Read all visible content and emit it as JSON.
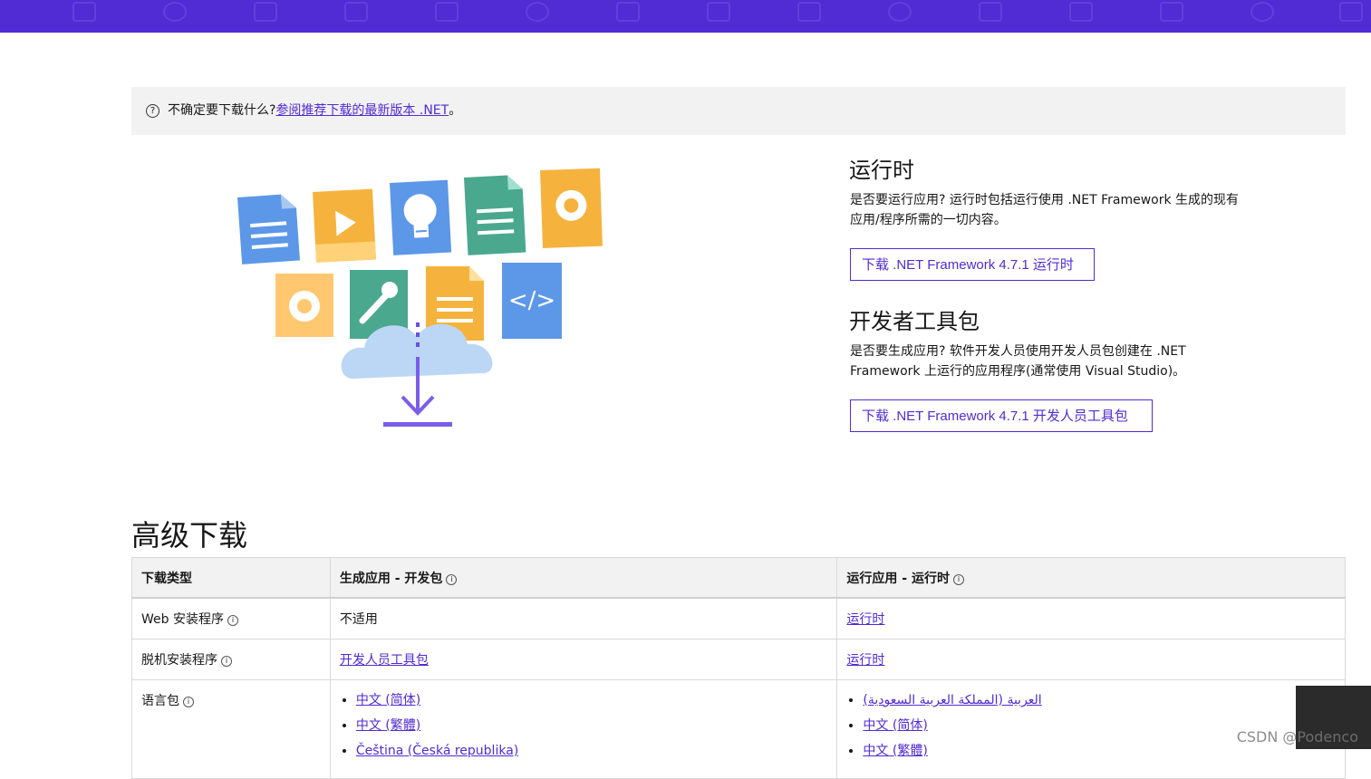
{
  "notice": {
    "prefix": "不确定要下载什么?",
    "link": "参阅推荐下载的最新版本 .NET",
    "suffix": "。"
  },
  "runtime": {
    "title": "运行时",
    "description": "是否要运行应用? 运行时包括运行使用 .NET Framework 生成的现有应用/程序所需的一切内容。",
    "button": "下载 .NET Framework 4.7.1 运行时"
  },
  "devpack": {
    "title": "开发者工具包",
    "description": "是否要生成应用? 软件开发人员使用开发人员包创建在 .NET Framework 上运行的应用程序(通常使用 Visual Studio)。",
    "button": "下载 .NET Framework 4.7.1 开发人员工具包"
  },
  "advanced": {
    "title": "高级下载",
    "headers": [
      "下载类型",
      "生成应用 - 开发包",
      "运行应用 - 运行时"
    ],
    "rows": [
      {
        "type": "Web 安装程序",
        "dev": "不适用",
        "runtime": "运行时"
      },
      {
        "type": "脱机安装程序",
        "dev": "开发人员工具包",
        "runtime": "运行时"
      },
      {
        "type": "语言包"
      }
    ],
    "dev_langs": [
      "中文 (简体)",
      "中文 (繁體)",
      "Čeština (Česká republika)"
    ],
    "runtime_langs": [
      "العربية (المملكة العربية السعودية)",
      "中文 (简体)",
      "中文 (繁體)"
    ]
  },
  "watermark": "CSDN @Podenco",
  "colors": {
    "brand": "#512bd4",
    "notice_bg": "#f2f2f2"
  }
}
